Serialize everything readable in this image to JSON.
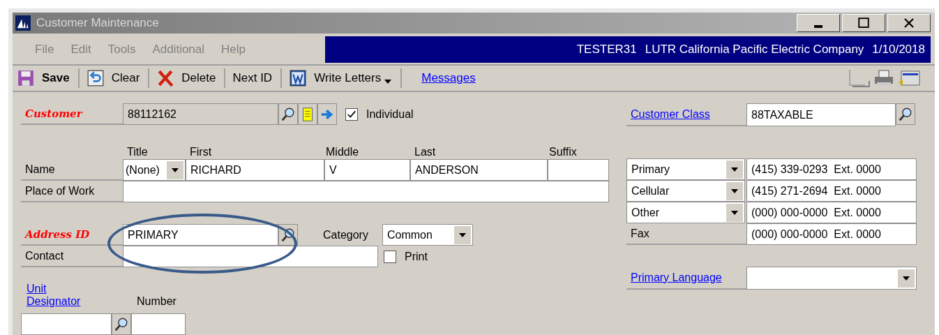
{
  "window": {
    "title": "Customer Maintenance"
  },
  "menu": [
    "File",
    "Edit",
    "Tools",
    "Additional",
    "Help"
  ],
  "status": {
    "user": "TESTER31",
    "company": "LUTR California Pacific Electric Company",
    "date": "1/10/2018"
  },
  "toolbar": [
    {
      "kind": "save",
      "label": "Save"
    },
    {
      "kind": "clear",
      "label": "Clear"
    },
    {
      "kind": "delete",
      "label": "Delete"
    },
    {
      "kind": "plain",
      "label": "Next ID"
    },
    {
      "kind": "word",
      "label": "Write Letters"
    },
    {
      "kind": "link",
      "label": "Messages"
    }
  ],
  "customer": {
    "label": "Customer",
    "required": true,
    "value": "88112162",
    "individual": {
      "label": "Individual",
      "checked": true
    }
  },
  "name": {
    "label": "Name",
    "required": false,
    "columns": [
      "Title",
      "First",
      "Middle",
      "Last",
      "Suffix"
    ],
    "title": "(None)",
    "first": "RICHARD",
    "middle": "V",
    "last": "ANDERSON"
  },
  "place_of_work": {
    "label": "Place of Work",
    "required": false
  },
  "address": {
    "label": "Address ID",
    "required": true,
    "value": "PRIMARY",
    "category_label": "Category",
    "category": "Common"
  },
  "contact": {
    "label": "Contact",
    "required": false,
    "print": {
      "label": "Print",
      "checked": false
    }
  },
  "unit": {
    "label": "Unit Designator",
    "number_label": "Number"
  },
  "customer_class": {
    "label": "Customer Class",
    "value": "88TAXABLE"
  },
  "phones": [
    {
      "kind": "select",
      "type": "Primary",
      "value": "(415) 339-0293  Ext. 0000"
    },
    {
      "kind": "select",
      "type": "Cellular",
      "value": "(415) 271-2694  Ext. 0000"
    },
    {
      "kind": "select",
      "type": "Other",
      "value": "(000) 000-0000  Ext. 0000"
    },
    {
      "kind": "label",
      "type": "Fax",
      "value": "(000) 000-0000  Ext. 0000"
    }
  ],
  "primary_language": {
    "label": "Primary Language"
  }
}
